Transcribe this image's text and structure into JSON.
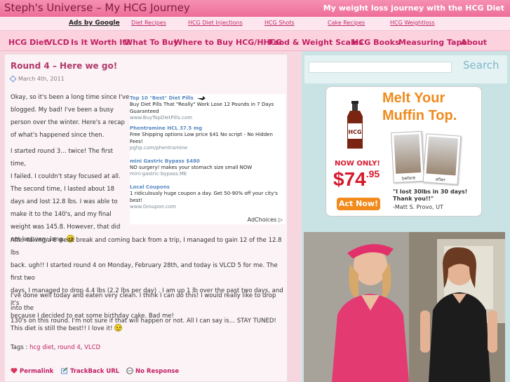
{
  "header": {
    "site_title": "Steph's Universe – My HCG Journey",
    "tagline": "My weight loss journey with the HCG Diet"
  },
  "adbar": {
    "ads_by": "Ads by Google",
    "links": [
      "Diet Recipes",
      "HCG Diet Injections",
      "HCG Shots",
      "Cake Recipes",
      "HCG Weightloss"
    ]
  },
  "nav": {
    "items": [
      "HCG Diet",
      "VLCD",
      "Is It Worth It?",
      "What To Buy",
      "Where to Buy HCG/HHCG",
      "Food & Weight Scales",
      "HCG Books",
      "Measuring Tape",
      "About"
    ]
  },
  "post": {
    "title": "Round 4 – Here we go!",
    "date": "March 4th, 2011",
    "p1": [
      "Okay, so it's been a long time since I've",
      "blogged. My bad! I've been a busy",
      "person over the winter. Here's a recap",
      "of what's happened since then."
    ],
    "p2": [
      "I started round 3… twice! The first time,",
      "I failed. I couldn't stay focused at all.",
      "The second time, I lasted about 18",
      "days and lost 12.8 lbs. I was able to",
      "make it to the 140's, and my final",
      "weight was 145.8. However, that did",
      "not last very long."
    ],
    "p3": [
      "After taking a 6 week break and coming back from a trip, I managed to gain 12 of the 12.8 lbs",
      "back. ugh!! I started round 4 on Monday, February 28th, and today is VLCD 5 for me. The first two",
      "days,  I managed to drop 4.4 lbs (2.2 lbs per day) . I am up 1 lb over the past two days, and it's",
      "because I decided to eat some birthday cake. Bad me!"
    ],
    "p4": [
      "I've done well today and eaten very clean. I think I can do this! I would really like to drop into the",
      "130's on this round. I'm not sure if that will happen or not. All I can say is… STAY TUNED!"
    ],
    "p5": "This diet is still the best!! I love it!",
    "tags_label": "Tags :",
    "tags": [
      "hcg diet",
      "round 4",
      "VLCD"
    ],
    "permalink": "Permalink",
    "trackback": "TrackBack URL",
    "no_response": "No Response"
  },
  "ads": [
    {
      "title": "Top 10 \"Best\" Diet Pills",
      "desc": "Buy Diet Pills That \"Really\" Work Lose 12 Pounds in 7 Days Guaranteed",
      "url": "www.BuyTopDietPills.com"
    },
    {
      "title": "Phentramine HCL 37.5 mg",
      "desc": "Free Shipping options Low price $41 No script - No Hidden Fees!",
      "url": "pghp.com/phentramine"
    },
    {
      "title": "mini Gastric Bypass $480",
      "desc": "NO surgery! makes your stomach size small NOW",
      "url": "mini-gastric-bypass.ME"
    },
    {
      "title": "Local Coupons",
      "desc": "1 ridiculously huge coupon a day. Get 50-90% off your city's best!",
      "url": "www.Groupon.com"
    }
  ],
  "adchoices": "AdChoices",
  "sidebar": {
    "search_label": "Search",
    "search_value": "",
    "promo": {
      "headline": [
        "Melt Your",
        "Muffin Top."
      ],
      "bottle_label": "HCG",
      "now_only": "NOW ONLY!",
      "price_main": "$74",
      "price_cents": ".95",
      "button": "Act Now!",
      "before": "before",
      "after": "after",
      "quote": "\"I lost 30lbs in 30 days! Thank you!!\"",
      "author": "-Matt S. Provo, UT"
    }
  },
  "colors": {
    "accent": "#c22063",
    "header": "#ee6d99",
    "sidebar": "#c9e3e4"
  }
}
